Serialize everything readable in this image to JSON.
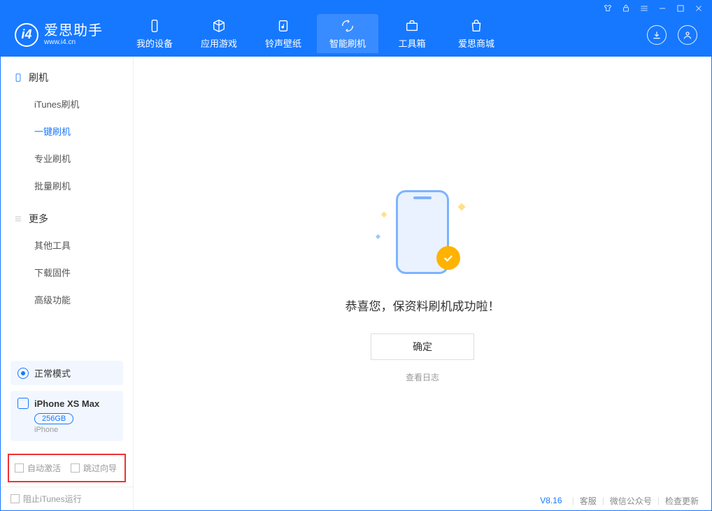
{
  "app": {
    "name_cn": "爱思助手",
    "name_en": "www.i4.cn"
  },
  "tabs": [
    {
      "label": "我的设备",
      "icon": "device"
    },
    {
      "label": "应用游戏",
      "icon": "cube"
    },
    {
      "label": "铃声壁纸",
      "icon": "music"
    },
    {
      "label": "智能刷机",
      "icon": "refresh",
      "active": true
    },
    {
      "label": "工具箱",
      "icon": "briefcase"
    },
    {
      "label": "爱思商城",
      "icon": "bag"
    }
  ],
  "sidebar": {
    "group1_title": "刷机",
    "group1_items": [
      "iTunes刷机",
      "一键刷机",
      "专业刷机",
      "批量刷机"
    ],
    "group1_active_index": 1,
    "group2_title": "更多",
    "group2_items": [
      "其他工具",
      "下载固件",
      "高级功能"
    ]
  },
  "status": {
    "mode": "正常模式"
  },
  "device": {
    "name": "iPhone XS Max",
    "storage": "256GB",
    "type": "iPhone"
  },
  "checks": {
    "auto_activate": "自动激活",
    "skip_guide": "跳过向导"
  },
  "block_itunes": "阻止iTunes运行",
  "main": {
    "success": "恭喜您，保资料刷机成功啦！",
    "ok": "确定",
    "view_log": "查看日志"
  },
  "footer": {
    "version": "V8.16",
    "support": "客服",
    "wechat": "微信公众号",
    "check_update": "检查更新"
  }
}
